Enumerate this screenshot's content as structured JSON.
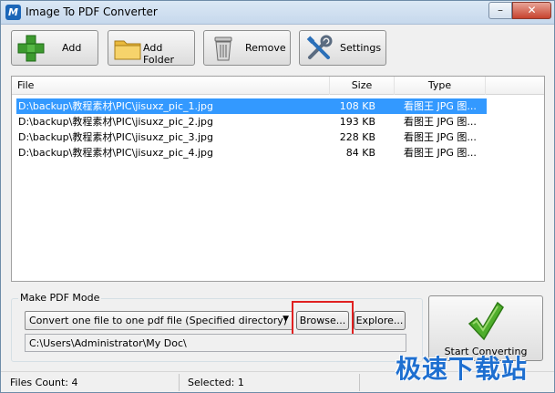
{
  "window": {
    "title": "Image To PDF Converter"
  },
  "toolbar": {
    "add_label": "Add",
    "add_folder_label": "Add Folder",
    "remove_label": "Remove",
    "settings_label": "Settings"
  },
  "file_list": {
    "columns": [
      "File",
      "Size",
      "Type"
    ],
    "rows": [
      {
        "file": "D:\\backup\\教程素材\\PIC\\jisuxz_pic_1.jpg",
        "size": "108 KB",
        "type": "看图王 JPG 图...",
        "selected": true
      },
      {
        "file": "D:\\backup\\教程素材\\PIC\\jisuxz_pic_2.jpg",
        "size": "193 KB",
        "type": "看图王 JPG 图...",
        "selected": false
      },
      {
        "file": "D:\\backup\\教程素材\\PIC\\jisuxz_pic_3.jpg",
        "size": "228 KB",
        "type": "看图王 JPG 图...",
        "selected": false
      },
      {
        "file": "D:\\backup\\教程素材\\PIC\\jisuxz_pic_4.jpg",
        "size": "84 KB",
        "type": "看图王 JPG 图...",
        "selected": false
      }
    ]
  },
  "mode": {
    "group_label": "Make PDF Mode",
    "selected_option": "Convert one file to one pdf file (Specified directory)",
    "browse_label": "Browse...",
    "explore_label": "Explore...",
    "output_path": "C:\\Users\\Administrator\\My Doc\\"
  },
  "start_label": "Start Converting",
  "status": {
    "files_count": "Files Count: 4",
    "selected": "Selected: 1"
  },
  "watermark": "极速下载站",
  "colors": {
    "selection": "#3399ff",
    "highlight_box": "#e02020",
    "close_button": "#c7432e",
    "watermark": "#1e6fd0"
  }
}
